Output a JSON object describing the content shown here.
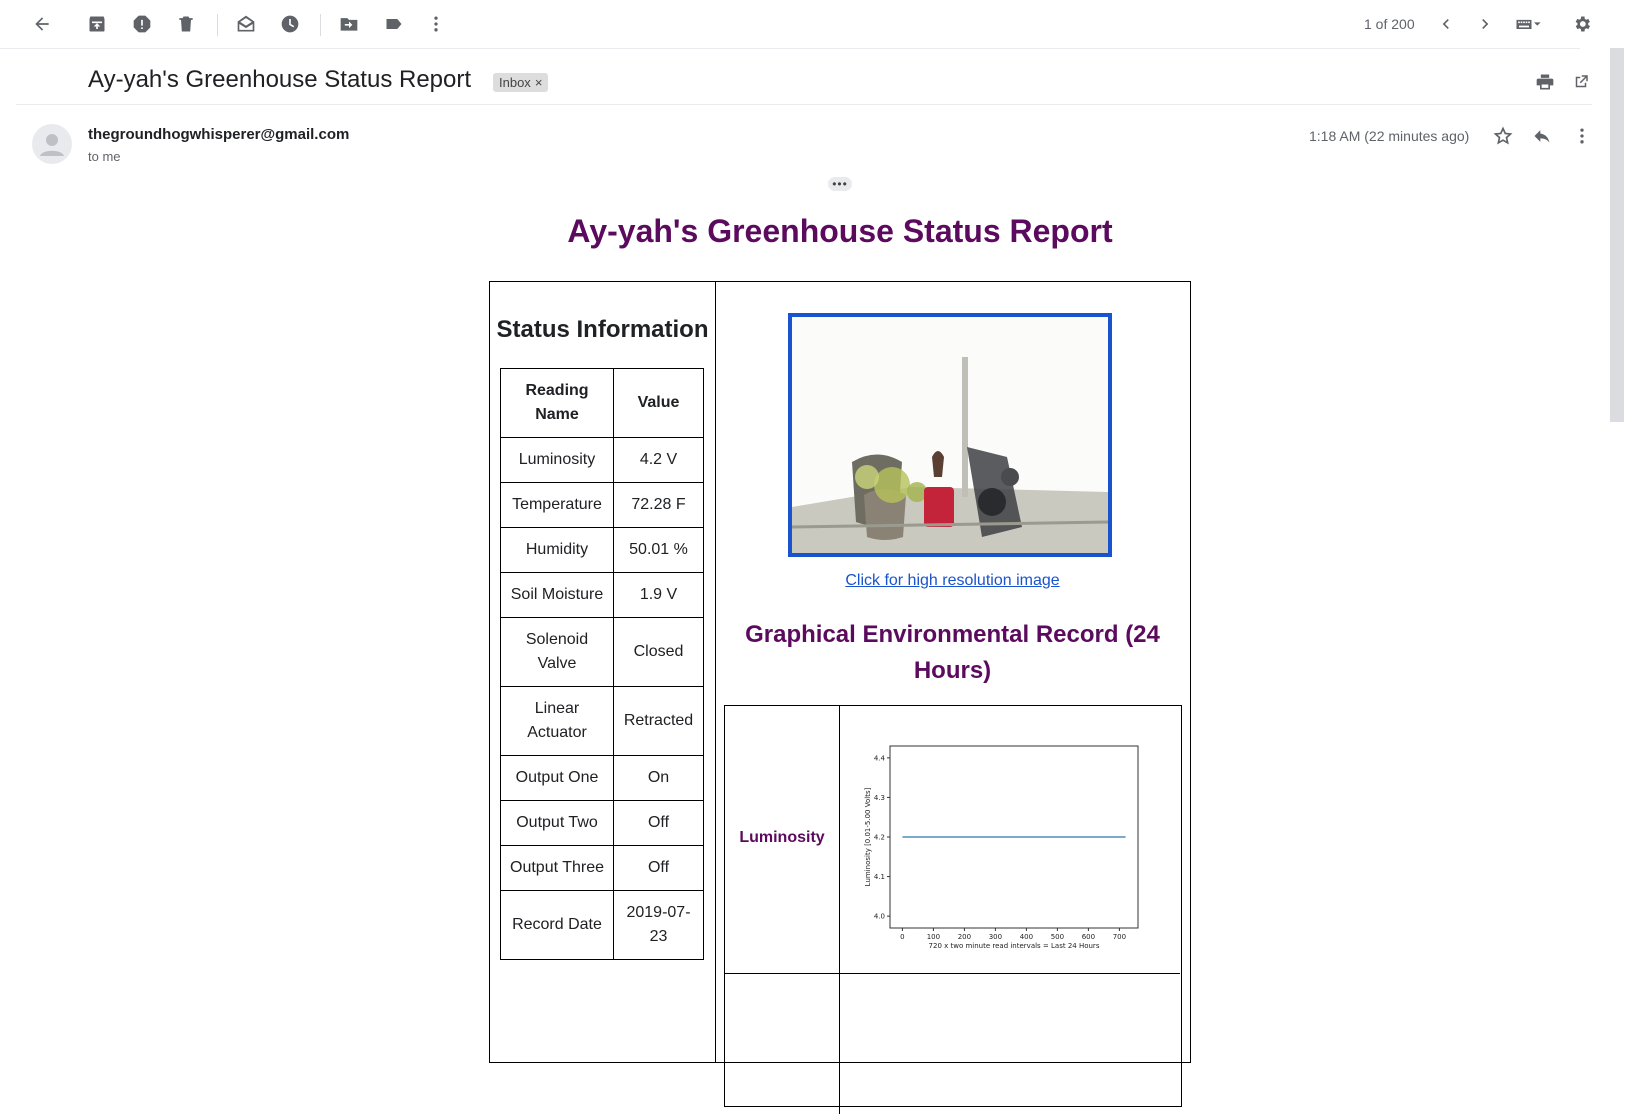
{
  "toolbar": {
    "pager": "1 of 200",
    "icons": [
      "back-arrow-icon",
      "archive-icon",
      "report-spam-icon",
      "delete-icon",
      "mark-unread-icon",
      "snooze-icon",
      "move-to-icon",
      "label-icon",
      "more-vert-icon",
      "chevron-left-icon",
      "chevron-right-icon",
      "keyboard-icon",
      "settings-gear-icon"
    ]
  },
  "email": {
    "subject": "Ay-yah's Greenhouse Status Report",
    "label_chip": "Inbox",
    "label_chip_close": "×",
    "sender": "thegroundhogwhisperer@gmail.com",
    "recipient": "to me",
    "time": "1:18 AM (22 minutes ago)",
    "expand_dots": "•••"
  },
  "report": {
    "title": "Ay-yah's Greenhouse Status Report",
    "status_title": "Status Information",
    "table_header": [
      "Reading Name",
      "Value"
    ],
    "rows": [
      [
        "Luminosity",
        "4.2 V"
      ],
      [
        "Temperature",
        "72.28 F"
      ],
      [
        "Humidity",
        "50.01 %"
      ],
      [
        "Soil Moisture",
        "1.9 V"
      ],
      [
        "Solenoid Valve",
        "Closed"
      ],
      [
        "Linear Actuator",
        "Retracted"
      ],
      [
        "Output One",
        "On"
      ],
      [
        "Output Two",
        "Off"
      ],
      [
        "Output Three",
        "Off"
      ],
      [
        "Record Date",
        "2019-07-23"
      ]
    ],
    "image_link": "Click for high resolution image",
    "graph_title": "Graphical Environmental Record (24 Hours)",
    "graph_label": "Luminosity"
  },
  "chart_data": {
    "type": "line",
    "title": "",
    "xlabel": "720 x two minute read intervals = Last 24 Hours",
    "ylabel": "Luminosity [0.01-5.00 Volts]",
    "xlim": [
      -40,
      760
    ],
    "ylim": [
      3.97,
      4.43
    ],
    "xticks": [
      0,
      100,
      200,
      300,
      400,
      500,
      600,
      700
    ],
    "yticks": [
      4.0,
      4.1,
      4.2,
      4.3,
      4.4
    ],
    "ytick_labels": [
      "4.0",
      "4.1",
      "4.2",
      "4.3",
      "4.4"
    ],
    "series": [
      {
        "color": "#4e8fba",
        "x": [
          0,
          720
        ],
        "y": [
          4.2,
          4.2
        ]
      }
    ]
  }
}
